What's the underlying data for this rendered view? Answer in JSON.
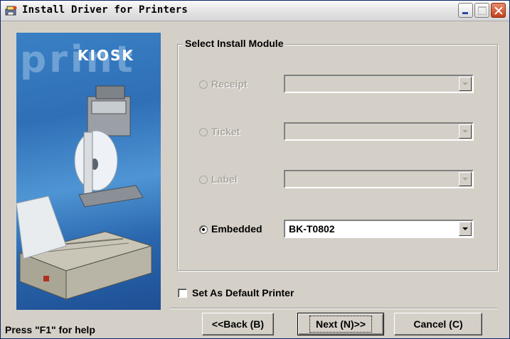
{
  "window": {
    "title": "Install Driver for Printers"
  },
  "banner": {
    "word": "print",
    "brand": "KIOSK"
  },
  "group": {
    "title": "Select Install Module",
    "modules": [
      {
        "label": "Receipt",
        "enabled": false,
        "selected": false,
        "value": ""
      },
      {
        "label": "Ticket",
        "enabled": false,
        "selected": false,
        "value": ""
      },
      {
        "label": "Label",
        "enabled": false,
        "selected": false,
        "value": ""
      },
      {
        "label": "Embedded",
        "enabled": true,
        "selected": true,
        "value": "BK-T0802"
      }
    ]
  },
  "default_printer": {
    "label": "Set As Default Printer",
    "checked": false
  },
  "buttons": {
    "back": "<<Back (B)",
    "next": "Next (N)>>",
    "cancel": "Cancel (C)"
  },
  "status": {
    "help": "Press \"F1\" for help"
  },
  "colors": {
    "titlebar": "#e7e7e7",
    "dialog": "#d4d0c8",
    "banner": "#2f6fb6",
    "close": "#c3401c"
  }
}
